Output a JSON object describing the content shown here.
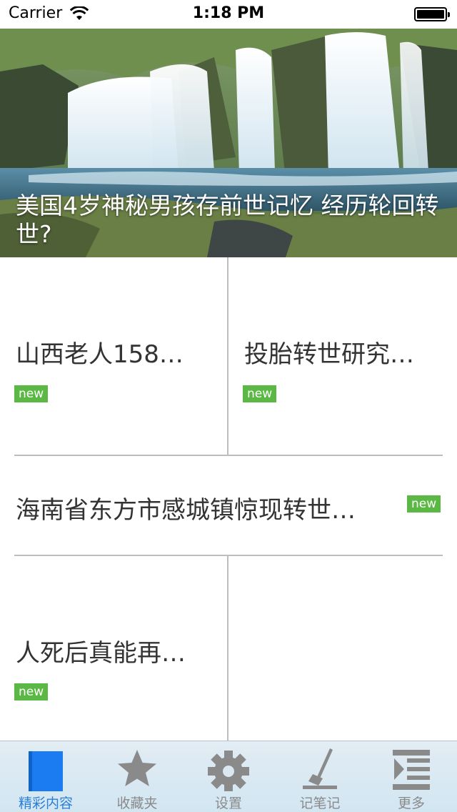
{
  "status_bar": {
    "carrier": "Carrier",
    "time": "1:18 PM"
  },
  "hero": {
    "title": "美国4岁神秘男孩存前世记忆 经历轮回转世?"
  },
  "articles": [
    {
      "title": "山西老人158…",
      "badge": "new"
    },
    {
      "title": "投胎转世研究…",
      "badge": "new"
    },
    {
      "title": "海南省东方市感城镇惊现转世…",
      "badge": "new"
    },
    {
      "title": "人死后真能再…",
      "badge": "new"
    }
  ],
  "tabs": [
    {
      "label": "精彩内容",
      "icon": "bookmark-icon",
      "active": true
    },
    {
      "label": "收藏夹",
      "icon": "star-icon",
      "active": false
    },
    {
      "label": "设置",
      "icon": "gear-icon",
      "active": false
    },
    {
      "label": "记笔记",
      "icon": "pen-icon",
      "active": false
    },
    {
      "label": "更多",
      "icon": "menu-icon",
      "active": false
    }
  ],
  "colors": {
    "accent": "#2a7fd8",
    "badge": "#5bb844",
    "divider": "#bdbdbd"
  }
}
